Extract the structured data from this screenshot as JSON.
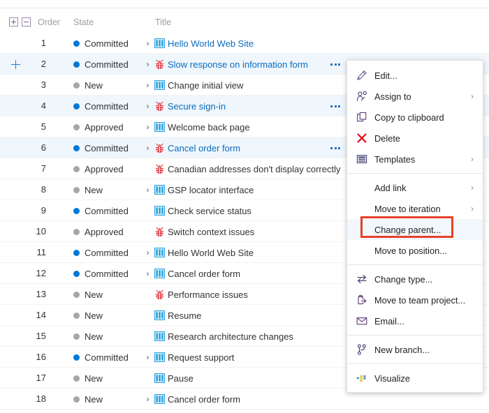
{
  "header": {
    "expand_all_icon": "plus-box-icon",
    "collapse_all_icon": "minus-box-icon",
    "columns": {
      "order": "Order",
      "state": "State",
      "title": "Title"
    }
  },
  "colors": {
    "committed_dot": "#0078d4",
    "inactive_dot": "#a6a6a6",
    "link": "#0b6cbf",
    "bug_icon": "#e03c46",
    "pbi_icon": "#29a3dd",
    "row_selected_bg": "#eff6fc",
    "highlight_box": "#e8402a",
    "delete_icon": "#e81123"
  },
  "rows": [
    {
      "order": "1",
      "state": "Committed",
      "state_type": "committed",
      "chevron": true,
      "icon": "pbi-icon",
      "title": "Hello World Web Site",
      "link": true,
      "selected": false,
      "ellipsis": false,
      "expand_plus": false
    },
    {
      "order": "2",
      "state": "Committed",
      "state_type": "committed",
      "chevron": true,
      "icon": "bug-icon",
      "title": "Slow response on information form",
      "link": true,
      "selected": true,
      "ellipsis": true,
      "expand_plus": true
    },
    {
      "order": "3",
      "state": "New",
      "state_type": "inactive",
      "chevron": true,
      "icon": "pbi-icon",
      "title": "Change initial view",
      "link": false,
      "selected": false,
      "ellipsis": false,
      "expand_plus": false
    },
    {
      "order": "4",
      "state": "Committed",
      "state_type": "committed",
      "chevron": true,
      "icon": "bug-icon",
      "title": "Secure sign-in",
      "link": true,
      "selected": true,
      "ellipsis": true,
      "expand_plus": false
    },
    {
      "order": "5",
      "state": "Approved",
      "state_type": "inactive",
      "chevron": true,
      "icon": "pbi-icon",
      "title": "Welcome back page",
      "link": false,
      "selected": false,
      "ellipsis": false,
      "expand_plus": false
    },
    {
      "order": "6",
      "state": "Committed",
      "state_type": "committed",
      "chevron": true,
      "icon": "bug-icon",
      "title": "Cancel order form",
      "link": true,
      "selected": true,
      "ellipsis": true,
      "expand_plus": false
    },
    {
      "order": "7",
      "state": "Approved",
      "state_type": "inactive",
      "chevron": false,
      "icon": "bug-icon",
      "title": "Canadian addresses don't display correctly",
      "link": false,
      "selected": false,
      "ellipsis": false,
      "expand_plus": false
    },
    {
      "order": "8",
      "state": "New",
      "state_type": "inactive",
      "chevron": true,
      "icon": "pbi-icon",
      "title": "GSP locator interface",
      "link": false,
      "selected": false,
      "ellipsis": false,
      "expand_plus": false
    },
    {
      "order": "9",
      "state": "Committed",
      "state_type": "committed",
      "chevron": false,
      "icon": "pbi-icon",
      "title": "Check service status",
      "link": false,
      "selected": false,
      "ellipsis": false,
      "expand_plus": false
    },
    {
      "order": "10",
      "state": "Approved",
      "state_type": "inactive",
      "chevron": false,
      "icon": "bug-icon",
      "title": "Switch context issues",
      "link": false,
      "selected": false,
      "ellipsis": false,
      "expand_plus": false
    },
    {
      "order": "11",
      "state": "Committed",
      "state_type": "committed",
      "chevron": true,
      "icon": "pbi-icon",
      "title": "Hello World Web Site",
      "link": false,
      "selected": false,
      "ellipsis": false,
      "expand_plus": false
    },
    {
      "order": "12",
      "state": "Committed",
      "state_type": "committed",
      "chevron": true,
      "icon": "pbi-icon",
      "title": "Cancel order form",
      "link": false,
      "selected": false,
      "ellipsis": false,
      "expand_plus": false
    },
    {
      "order": "13",
      "state": "New",
      "state_type": "inactive",
      "chevron": false,
      "icon": "bug-icon",
      "title": "Performance issues",
      "link": false,
      "selected": false,
      "ellipsis": false,
      "expand_plus": false
    },
    {
      "order": "14",
      "state": "New",
      "state_type": "inactive",
      "chevron": false,
      "icon": "pbi-icon",
      "title": "Resume",
      "link": false,
      "selected": false,
      "ellipsis": false,
      "expand_plus": false
    },
    {
      "order": "15",
      "state": "New",
      "state_type": "inactive",
      "chevron": false,
      "icon": "pbi-icon",
      "title": "Research architecture changes",
      "link": false,
      "selected": false,
      "ellipsis": false,
      "expand_plus": false
    },
    {
      "order": "16",
      "state": "Committed",
      "state_type": "committed",
      "chevron": true,
      "icon": "pbi-icon",
      "title": "Request support",
      "link": false,
      "selected": false,
      "ellipsis": false,
      "expand_plus": false
    },
    {
      "order": "17",
      "state": "New",
      "state_type": "inactive",
      "chevron": false,
      "icon": "pbi-icon",
      "title": "Pause",
      "link": false,
      "selected": false,
      "ellipsis": false,
      "expand_plus": false
    },
    {
      "order": "18",
      "state": "New",
      "state_type": "inactive",
      "chevron": true,
      "icon": "pbi-icon",
      "title": "Cancel order form",
      "link": false,
      "selected": false,
      "ellipsis": false,
      "expand_plus": false
    }
  ],
  "context_menu": {
    "groups": [
      {
        "items": [
          {
            "label": "Edit...",
            "icon": "pencil-icon",
            "submenu": false,
            "indent": false,
            "highlighted": false
          },
          {
            "label": "Assign to",
            "icon": "assign-person-icon",
            "submenu": true,
            "indent": false,
            "highlighted": false
          },
          {
            "label": "Copy to clipboard",
            "icon": "copy-icon",
            "submenu": false,
            "indent": false,
            "highlighted": false
          },
          {
            "label": "Delete",
            "icon": "delete-x-icon",
            "submenu": false,
            "indent": false,
            "highlighted": false
          },
          {
            "label": "Templates",
            "icon": "templates-icon",
            "submenu": true,
            "indent": false,
            "highlighted": false
          }
        ]
      },
      {
        "items": [
          {
            "label": "Add link",
            "icon": "none",
            "submenu": true,
            "indent": true,
            "highlighted": false
          },
          {
            "label": "Move to iteration",
            "icon": "none",
            "submenu": true,
            "indent": true,
            "highlighted": false
          },
          {
            "label": "Change parent...",
            "icon": "none",
            "submenu": false,
            "indent": true,
            "highlighted": true
          },
          {
            "label": "Move to position...",
            "icon": "none",
            "submenu": false,
            "indent": true,
            "highlighted": false
          }
        ]
      },
      {
        "items": [
          {
            "label": "Change type...",
            "icon": "change-type-icon",
            "submenu": false,
            "indent": false,
            "highlighted": false
          },
          {
            "label": "Move to team project...",
            "icon": "move-project-icon",
            "submenu": false,
            "indent": false,
            "highlighted": false
          },
          {
            "label": "Email...",
            "icon": "email-icon",
            "submenu": false,
            "indent": false,
            "highlighted": false
          }
        ]
      },
      {
        "items": [
          {
            "label": "New branch...",
            "icon": "branch-icon",
            "submenu": false,
            "indent": false,
            "highlighted": false
          }
        ]
      },
      {
        "items": [
          {
            "label": "Visualize",
            "icon": "visualize-icon",
            "submenu": false,
            "indent": false,
            "highlighted": false
          }
        ]
      }
    ],
    "submenu_glyph": "›"
  },
  "annotation": {
    "target_item": "Change parent..."
  }
}
